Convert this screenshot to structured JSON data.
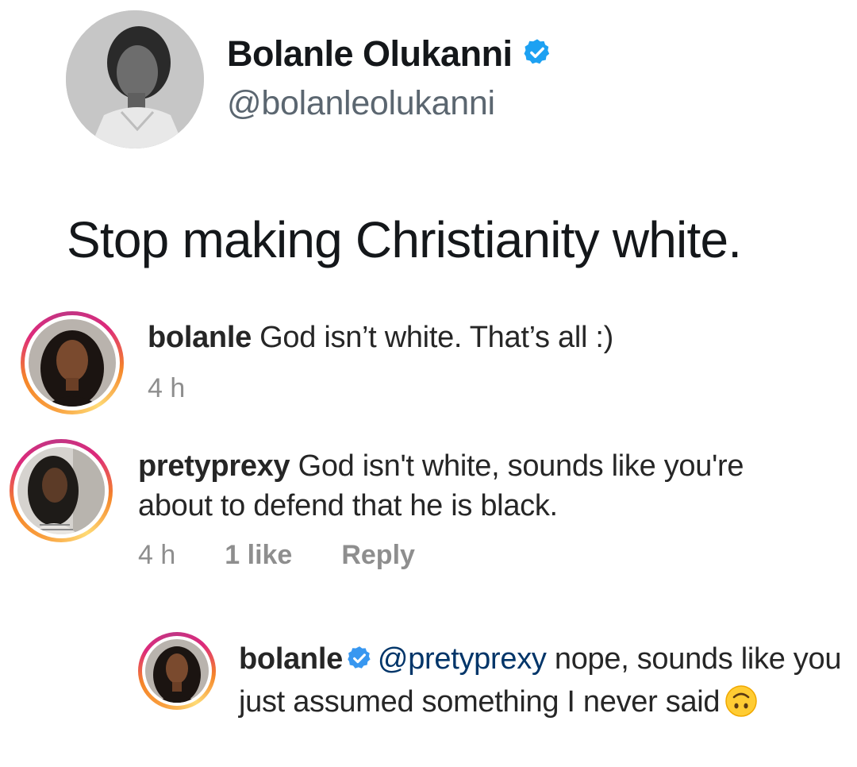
{
  "tweet": {
    "author_name": "Bolanle Olukanni",
    "handle": "@bolanleolukanni",
    "verified": true,
    "text": "Stop making Christianity white."
  },
  "comments": [
    {
      "username": "bolanle",
      "text": " God isn’t white. That’s all :)",
      "time": "4 h"
    },
    {
      "username": "pretyprexy",
      "text": " God isn't white, sounds like you're about to defend that he is black.",
      "time": "4 h",
      "likes": "1 like",
      "reply_label": "Reply"
    },
    {
      "username": "bolanle",
      "verified": true,
      "mention": "@pretyprexy",
      "text": " nope, sounds like you just assumed something I never said",
      "emoji": "upside-down-face-icon"
    }
  ],
  "colors": {
    "verified_blue": "#1da1f2",
    "mention_blue": "#003569",
    "meta_gray": "#8e8e8e",
    "handle_gray": "#5b6670"
  }
}
